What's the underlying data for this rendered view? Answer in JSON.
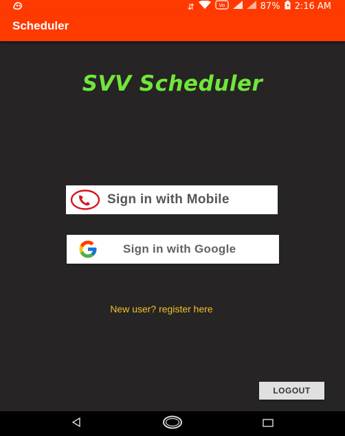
{
  "status_bar": {
    "battery": "87%",
    "time": "2:16 AM"
  },
  "app_bar": {
    "title": "Scheduler"
  },
  "main": {
    "heading": "SVV Scheduler",
    "mobile_button_label": "Sign in with Mobile",
    "google_button_label": "Sign in with Google",
    "register_link": "New user? register here",
    "logout_label": "LOGOUT"
  },
  "icons": {
    "status_left": "app-notification-icon",
    "mobile": "phone-icon",
    "google": "google-logo-icon",
    "nav_back": "back-triangle-icon",
    "nav_home": "home-circle-icon",
    "nav_recents": "recents-square-icon"
  },
  "colors": {
    "accent": "#ff3a00",
    "heading": "#71e63a",
    "link": "#f2c12b",
    "background": "#262424"
  }
}
